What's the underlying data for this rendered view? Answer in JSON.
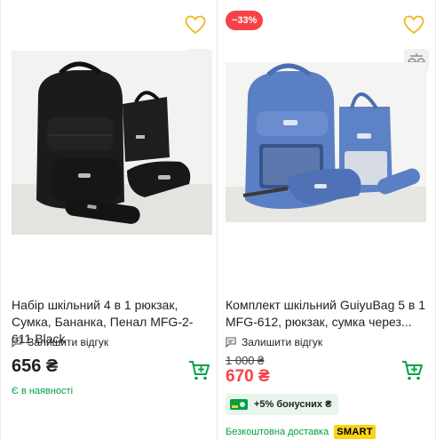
{
  "products": [
    {
      "title": "Набір шкільний 4 в 1 рюкзак, Сумка, Бананка, Пенал MFG-2-611 Black",
      "review_label": "Залишити відгук",
      "price": "656 ₴",
      "availability": "Є в наявності",
      "icons": {
        "favorite": "heart-icon",
        "compare": "scales-icon",
        "cart": "cart-icon",
        "review": "comment-icon"
      },
      "image_desc_color": "#1b1b1b"
    },
    {
      "discount_badge": "−33%",
      "title": "Комплект шкільний GuiyuBag 5 в 1 MFG-612, рюкзак, сумка через...",
      "review_label": "Залишити відгук",
      "old_price": "1 000 ₴",
      "price": "670 ₴",
      "bonus_text": "+5% бонусних ₴",
      "delivery_text": "Безкоштовна доставка",
      "delivery_badge": "SMART",
      "icons": {
        "favorite": "heart-icon",
        "compare": "scales-icon",
        "cart": "cart-icon",
        "review": "comment-icon",
        "bonus": "bonus-card-icon"
      },
      "image_desc_color": "#5b7fc4"
    }
  ],
  "colors": {
    "accent_green": "#00a046",
    "price_red": "#f84147",
    "favorite_yellow": "#f3b51c",
    "smart_yellow": "#fcd317"
  }
}
